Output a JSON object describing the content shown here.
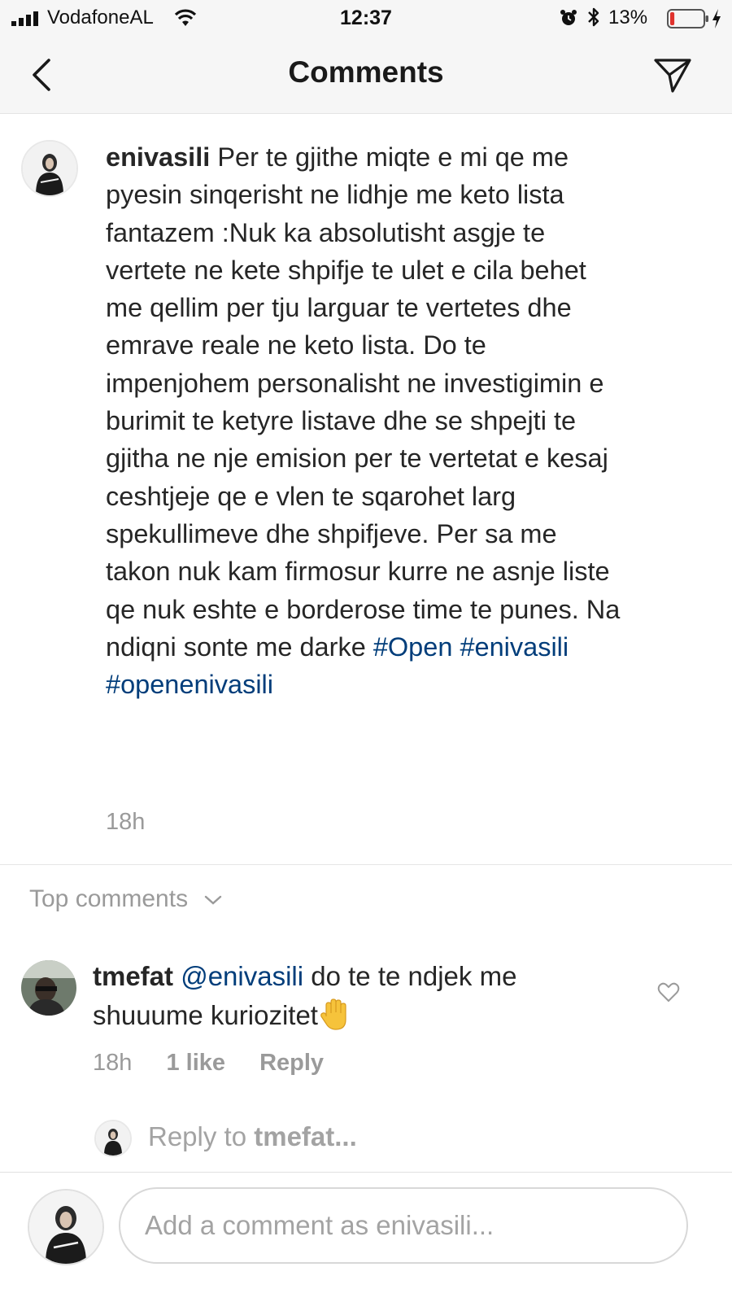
{
  "status_bar": {
    "carrier": "VodafoneAL",
    "time": "12:37",
    "battery_percent": "13%",
    "battery_level": 0.13,
    "icons": [
      "signal-icon",
      "wifi-icon",
      "alarm-icon",
      "bluetooth-icon",
      "battery-icon",
      "charging-icon"
    ]
  },
  "nav": {
    "title": "Comments",
    "back_icon": "chevron-left-icon",
    "send_icon": "paper-plane-icon"
  },
  "caption": {
    "username": "enivasili",
    "text": "Per te gjithe miqte e mi qe me pyesin sinqerisht ne lidhje me keto lista fantazem :Nuk ka absolutisht asgje te vertete ne kete shpifje te ulet e cila behet me qellim per tju larguar te vertetes dhe emrave reale ne keto lista. Do te impenjohem personalisht ne investigimin e burimit te ketyre listave dhe se  shpejti te gjitha ne nje emision per te vertetat e kesaj ceshtjeje qe e vlen te sqarohet larg spekullimeve dhe shpifjeve. Per sa me takon nuk kam firmosur kurre ne asnje liste qe nuk eshte e borderose time te punes. Na ndiqni sonte me darke",
    "hashtags": [
      "#Open",
      "#enivasili",
      "#openenivasili"
    ],
    "time": "18h"
  },
  "top_comments": {
    "label": "Top comments"
  },
  "comment": {
    "username": "tmefat",
    "mention": "@enivasili",
    "text": "do te te ndjek me shuuume kuriozitet",
    "emoji": "raised-hand-icon",
    "time": "18h",
    "likes": "1 like",
    "reply_label": "Reply"
  },
  "reply_prompt": {
    "prefix": "Reply to",
    "username": "tmefat..."
  },
  "composer": {
    "placeholder": "Add a comment as enivasili..."
  },
  "colors": {
    "link": "#003d7a",
    "muted": "#9a9a9a",
    "bar_bg": "#f6f6f6",
    "battery_low": "#e0332e"
  }
}
